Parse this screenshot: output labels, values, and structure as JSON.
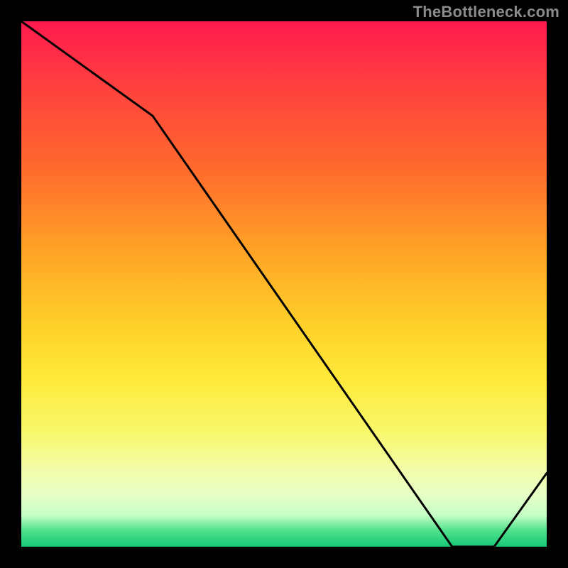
{
  "watermark": "TheBottleneck.com",
  "chart_data": {
    "type": "line",
    "title": "",
    "xlabel": "",
    "ylabel": "",
    "x": [
      0,
      25,
      82,
      90,
      100
    ],
    "values": [
      100,
      82,
      0,
      0,
      14
    ],
    "xlim": [
      0,
      100
    ],
    "ylim": [
      0,
      100
    ],
    "baseline_label": "",
    "baseline_y": 0,
    "baseline_x_range": [
      82,
      90
    ],
    "grid": false,
    "legend": false,
    "background": "rainbow-gradient-vertical",
    "frame_color": "#000000"
  },
  "colors": {
    "line": "#000000",
    "frame": "#000000",
    "watermark": "#8b8b8b",
    "baseline_text": "#e11919"
  }
}
